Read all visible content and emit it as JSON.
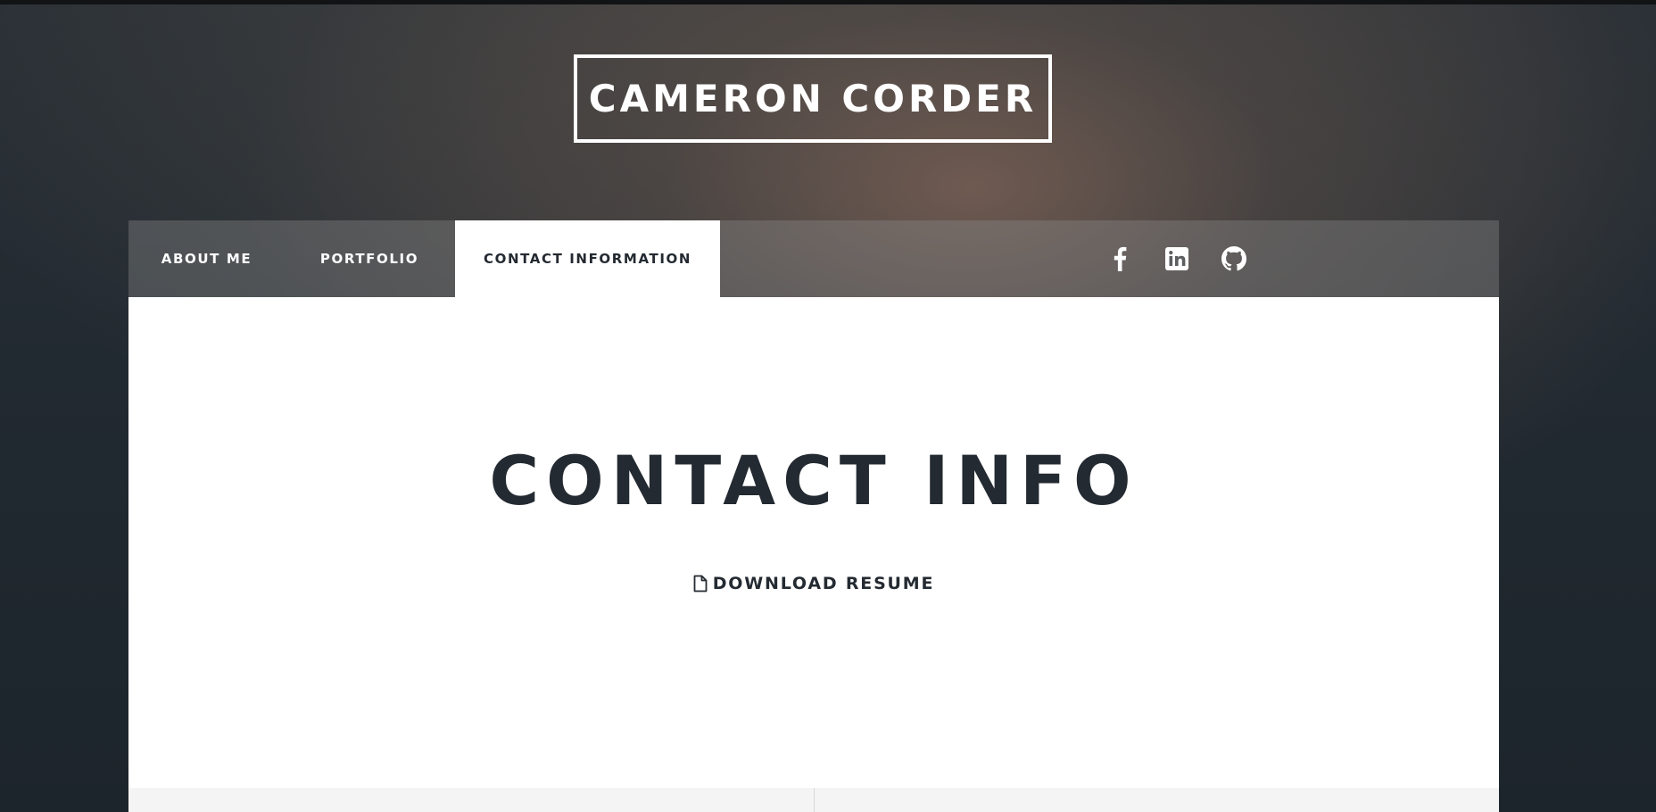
{
  "header": {
    "title": "CAMERON CORDER"
  },
  "nav": {
    "items": [
      {
        "label": "ABOUT ME",
        "active": false
      },
      {
        "label": "PORTFOLIO",
        "active": false
      },
      {
        "label": "CONTACT INFORMATION",
        "active": true
      }
    ],
    "social": [
      {
        "icon": "facebook-icon"
      },
      {
        "icon": "linkedin-icon"
      },
      {
        "icon": "github-icon"
      }
    ]
  },
  "main": {
    "heading": "CONTACT INFO",
    "download": {
      "icon": "file-icon",
      "label": "DOWNLOAD RESUME"
    }
  },
  "colors": {
    "text_dark": "#242a31",
    "white": "#ffffff",
    "background": "#1f262d"
  }
}
